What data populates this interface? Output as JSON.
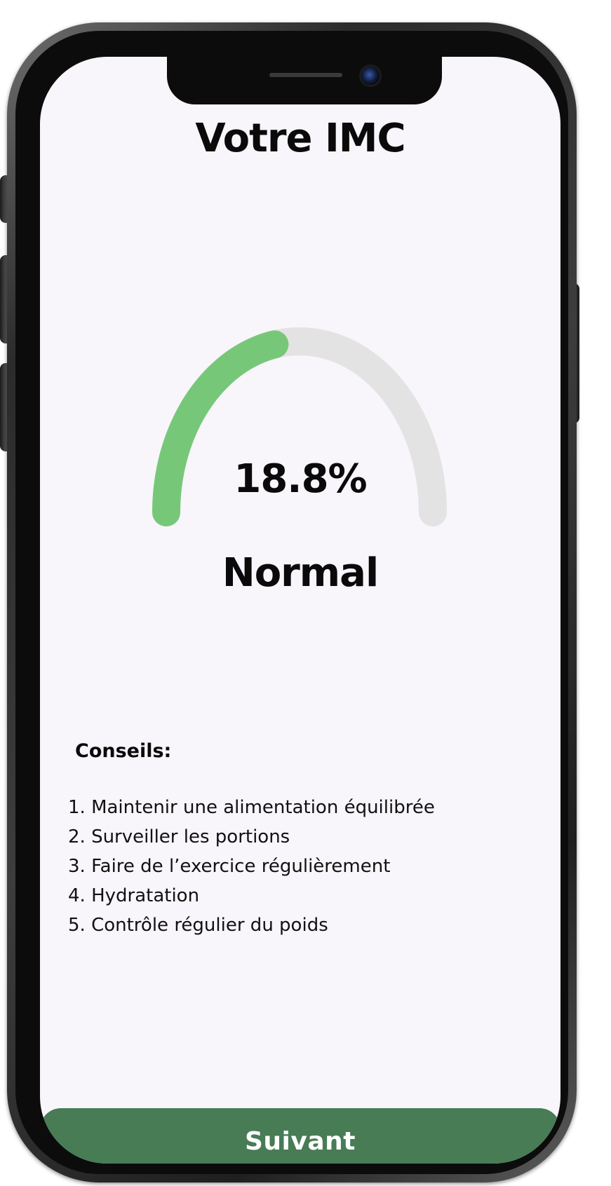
{
  "header": {
    "title": "Votre IMC"
  },
  "gauge": {
    "fill_fraction": 0.44,
    "track_color": "#e3e3e3",
    "fill_color": "#76c878"
  },
  "result": {
    "value_text": "18.8%",
    "status": "Normal"
  },
  "advice": {
    "heading": "Conseils:",
    "items": [
      "1. Maintenir une alimentation équilibrée",
      "2. Surveiller les portions",
      "3. Faire de l’exercice régulièrement",
      "4. Hydratation",
      "5. Contrôle régulier du poids"
    ]
  },
  "footer": {
    "next_label": "Suivant",
    "button_color": "#477c55"
  },
  "device": {
    "icons": [
      "speaker-grille-icon",
      "front-camera-icon"
    ]
  }
}
